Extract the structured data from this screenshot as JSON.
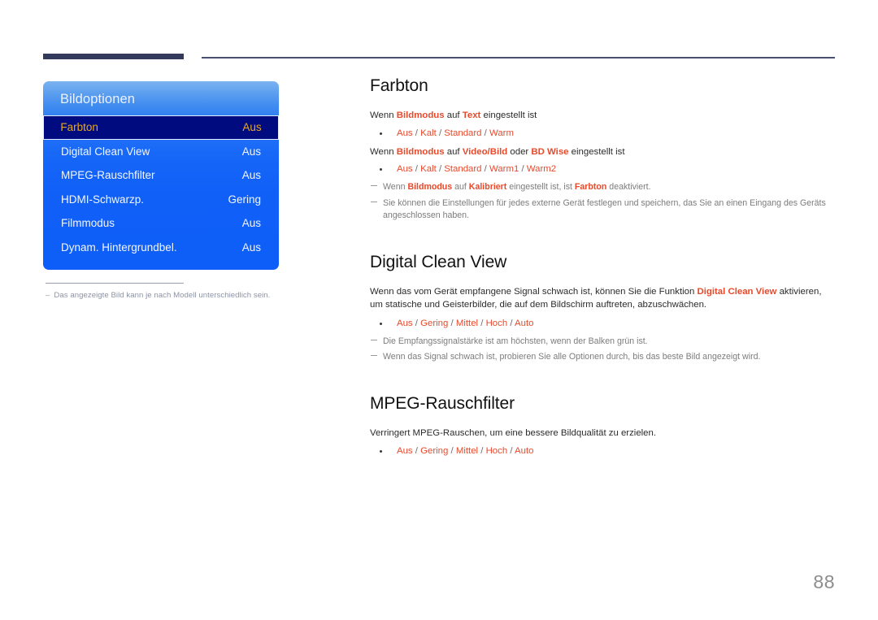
{
  "page": {
    "number": "88"
  },
  "osd": {
    "title": "Bildoptionen",
    "rows": [
      {
        "label": "Farbton",
        "value": "Aus",
        "selected": true
      },
      {
        "label": "Digital Clean View",
        "value": "Aus",
        "selected": false
      },
      {
        "label": "MPEG-Rauschfilter",
        "value": "Aus",
        "selected": false
      },
      {
        "label": "HDMI-Schwarzp.",
        "value": "Gering",
        "selected": false
      },
      {
        "label": "Filmmodus",
        "value": "Aus",
        "selected": false
      },
      {
        "label": "Dynam. Hintergrundbel.",
        "value": "Aus",
        "selected": false
      }
    ],
    "footnote": {
      "dash": "–",
      "text": "Das angezeigte Bild kann je nach Modell unterschiedlich sein."
    }
  },
  "sections": {
    "farbton": {
      "title": "Farbton",
      "line1": {
        "a": "Wenn ",
        "term1": "Bildmodus",
        "b": " auf ",
        "term2": "Text",
        "c": " eingestellt ist"
      },
      "options1": {
        "o1": "Aus",
        "o2": "Kalt",
        "o3": "Standard",
        "o4": "Warm"
      },
      "line2": {
        "a": "Wenn ",
        "term1": "Bildmodus",
        "b": " auf ",
        "term2": "Video/Bild",
        "c": " oder ",
        "term3": "BD Wise",
        "d": " eingestellt ist"
      },
      "options2": {
        "o1": "Aus",
        "o2": "Kalt",
        "o3": "Standard",
        "o4": "Warm1",
        "o5": "Warm2"
      },
      "note1": {
        "a": "Wenn ",
        "term1": "Bildmodus",
        "b": " auf ",
        "term2": "Kalibriert",
        "c": " eingestellt ist, ist ",
        "term3": "Farbton",
        "d": " deaktiviert."
      },
      "note2": "Sie können die Einstellungen für jedes externe Gerät festlegen und speichern, das Sie an einen Eingang des Geräts angeschlossen haben."
    },
    "digital_clean_view": {
      "title": "Digital Clean View",
      "body": {
        "a": "Wenn das vom Gerät empfangene Signal schwach ist, können Sie die Funktion ",
        "term1": "Digital Clean View",
        "b": " aktivieren, um statische und Geisterbilder, die auf dem Bildschirm auftreten, abzuschwächen."
      },
      "options": {
        "o1": "Aus",
        "o2": "Gering",
        "o3": "Mittel",
        "o4": "Hoch",
        "o5": "Auto"
      },
      "note1": "Die Empfangssignalstärke ist am höchsten, wenn der Balken grün ist.",
      "note2": "Wenn das Signal schwach ist, probieren Sie alle Optionen durch, bis das beste Bild angezeigt wird."
    },
    "mpeg": {
      "title": "MPEG-Rauschfilter",
      "body": "Verringert MPEG-Rauschen, um eine bessere Bildqualität zu erzielen.",
      "options": {
        "o1": "Aus",
        "o2": "Gering",
        "o3": "Mittel",
        "o4": "Hoch",
        "o5": "Auto"
      }
    }
  },
  "separator": "/",
  "colors": {
    "accent_red": "#e8492b",
    "osd_blue": "#0d5df8",
    "osd_selected_bg": "#000b80",
    "osd_selected_text": "#e8a81b",
    "rule_navy": "#343a5c"
  }
}
